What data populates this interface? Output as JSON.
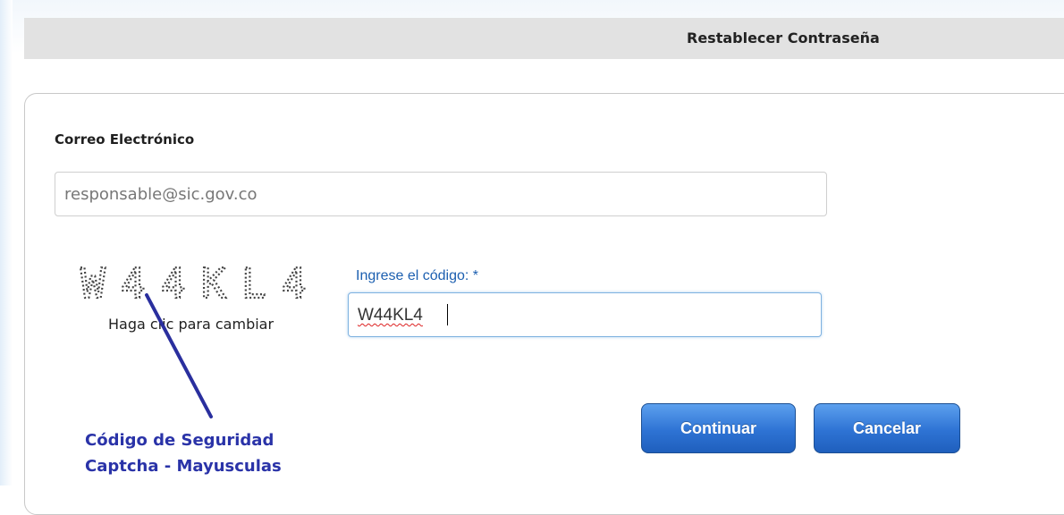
{
  "header": {
    "title": "Restablecer Contraseña"
  },
  "form": {
    "email_label": "Correo Electrónico",
    "email_placeholder": "responsable@sic.gov.co",
    "captcha_text": "W44KL4",
    "captcha_hint": "Haga clic para cambiar",
    "code_label": "Ingrese el código: *",
    "code_value": "W44KL4"
  },
  "buttons": {
    "continue": "Continuar",
    "cancel": "Cancelar"
  },
  "annotation": {
    "line1": "Código de Seguridad",
    "line2": "Captcha - Mayusculas"
  },
  "colors": {
    "accent": "#2e73d4",
    "label_blue": "#1c5fb0",
    "annotation": "#2a33a8",
    "header_bar": "#e2e2e2"
  }
}
